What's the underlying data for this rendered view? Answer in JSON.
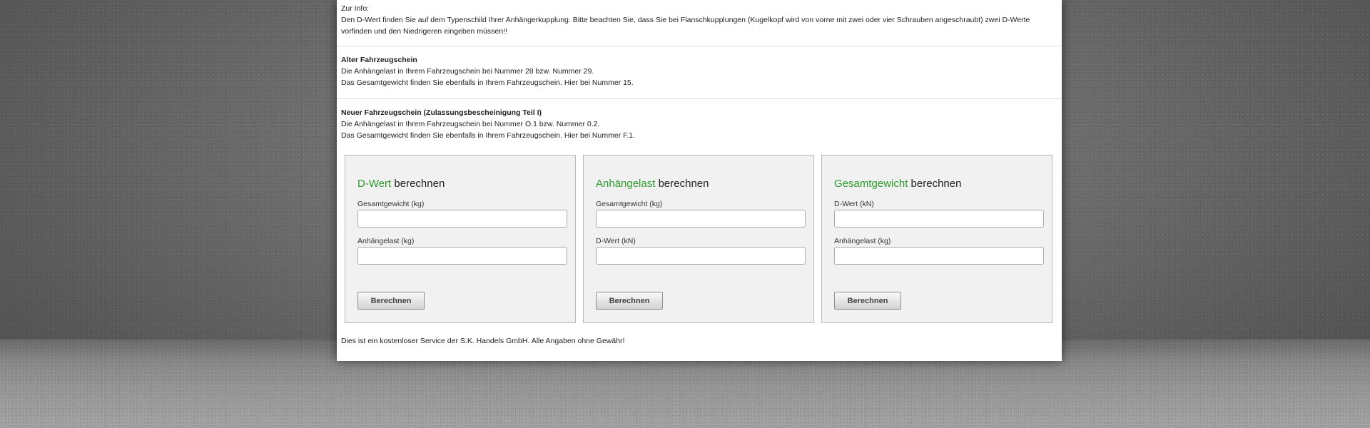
{
  "info": {
    "heading": "Zur Info:",
    "line1": "Den D-Wert finden Sie auf dem Typenschild Ihrer Anhängerkupplung. Bitte beachten Sie, dass Sie bei Flanschkupplungen (Kugelkopf wird von vorne mit zwei oder vier Schrauben angeschraubt) zwei D-Werte",
    "line2": "vorfinden und den Niedrigeren eingeben müssen!!"
  },
  "old_registration": {
    "title": "Alter Fahrzeugschein",
    "line1": "Die Anhängelast in Ihrem Fahrzeugschein bei Nummer 28 bzw. Nummer 29.",
    "line2": "Das Gesamtgewicht finden Sie ebenfalls in Ihrem Fahrzeugschein. Hier bei Nummer 15."
  },
  "new_registration": {
    "title": "Neuer Fahrzeugschein (Zulassungsbescheinigung Teil I)",
    "line1": "Die Anhängelast in Ihrem Fahrzeugschein bei Nummer O.1 bzw. Nummer 0.2.",
    "line2": "Das Gesamtgewicht finden Sie ebenfalls in Ihrem Fahrzeugschein. Hier bei Nummer F.1."
  },
  "calculators": [
    {
      "title_highlight": "D-Wert",
      "title_rest": " berechnen",
      "field1_label": "Gesamtgewicht (kg)",
      "field1_value": "",
      "field2_label": "Anhängelast (kg)",
      "field2_value": "",
      "button": "Berechnen"
    },
    {
      "title_highlight": "Anhängelast",
      "title_rest": " berechnen",
      "field1_label": "Gesamtgewicht (kg)",
      "field1_value": "",
      "field2_label": "D-Wert (kN)",
      "field2_value": "",
      "button": "Berechnen"
    },
    {
      "title_highlight": "Gesamtgewicht",
      "title_rest": " berechnen",
      "field1_label": "D-Wert (kN)",
      "field1_value": "",
      "field2_label": "Anhängelast (kg)",
      "field2_value": "",
      "button": "Berechnen"
    }
  ],
  "footer": "Dies ist ein kostenloser Service der S.K. Handels GmbH. Alle Angaben ohne Gewähr!",
  "colors": {
    "highlight_green": "#2e9a2e",
    "panel_background": "#ffffff",
    "calculator_background": "#f1f1f1"
  }
}
